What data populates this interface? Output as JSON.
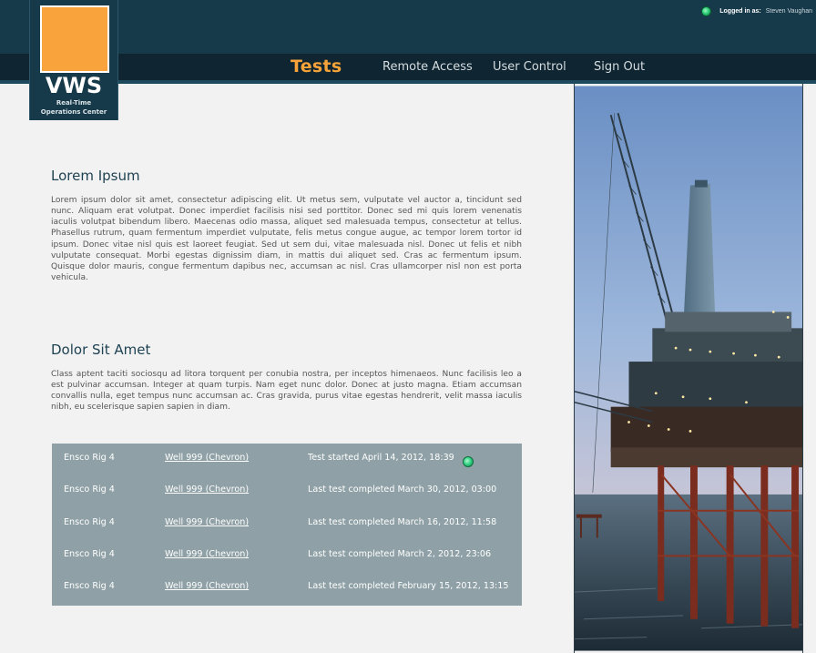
{
  "header": {
    "logged_in_label": "Logged in as:",
    "username": "Steven Vaughan"
  },
  "logo": {
    "title": "VWS",
    "subtitle_line1": "Real-Time",
    "subtitle_line2": "Operations Center"
  },
  "nav": {
    "items": [
      {
        "label": "Tests"
      },
      {
        "label": "Remote Access"
      },
      {
        "label": "User Control"
      },
      {
        "label": "Sign Out"
      }
    ]
  },
  "sections": [
    {
      "title": "Lorem Ipsum",
      "body": "Lorem ipsum dolor sit amet, consectetur adipiscing elit. Ut metus sem, vulputate vel auctor a, tincidunt sed nunc. Aliquam erat volutpat. Donec imperdiet facilisis nisi sed porttitor. Donec sed mi quis lorem venenatis iaculis volutpat bibendum libero. Maecenas odio massa, aliquet sed malesuada tempus, consectetur at tellus. Phasellus rutrum, quam fermentum imperdiet vulputate, felis metus congue augue, ac tempor lorem tortor id ipsum. Donec vitae nisl quis est laoreet feugiat. Sed ut sem dui, vitae malesuada nisl. Donec ut felis et nibh vulputate consequat. Morbi egestas dignissim diam, in mattis dui aliquet sed. Cras ac fermentum ipsum. Quisque dolor mauris, congue fermentum dapibus nec, accumsan ac nisl. Cras ullamcorper nisl non est porta vehicula."
    },
    {
      "title": "Dolor Sit Amet",
      "body": "Class aptent taciti sociosqu ad litora torquent per conubia nostra, per inceptos himenaeos. Nunc facilisis leo a est pulvinar accumsan. Integer at quam turpis. Nam eget nunc dolor. Donec at justo magna. Etiam accumsan convallis nulla, eget tempus nunc accumsan ac. Cras gravida, purus vitae egestas hendrerit, velit massa iaculis nibh, eu scelerisque sapien sapien in diam."
    }
  ],
  "tests_table": {
    "rows": [
      {
        "rig": "Ensco Rig 4",
        "well": "Well 999 (Chevron)",
        "status": "Test started April 14, 2012, 18:39",
        "active": true
      },
      {
        "rig": "Ensco Rig 4",
        "well": "Well 999 (Chevron)",
        "status": "Last test completed March 30, 2012, 03:00",
        "active": false
      },
      {
        "rig": "Ensco Rig 4",
        "well": "Well 999 (Chevron)",
        "status": "Last test completed March 16, 2012, 11:58",
        "active": false
      },
      {
        "rig": "Ensco Rig 4",
        "well": "Well 999 (Chevron)",
        "status": "Last test completed March 2, 2012, 23:06",
        "active": false
      },
      {
        "rig": "Ensco Rig 4",
        "well": "Well 999 (Chevron)",
        "status": "Last test completed February 15, 2012, 13:15",
        "active": false
      }
    ]
  },
  "icons": {
    "login_status": "online-status-icon",
    "test_status": "active-test-status-icon"
  },
  "colors": {
    "header_bg": "#173a4a",
    "nav_bg": "#0f2531",
    "accent_orange": "#f7a33a",
    "table_bg": "#8fa1a6",
    "status_green": "#2fcf7a"
  }
}
